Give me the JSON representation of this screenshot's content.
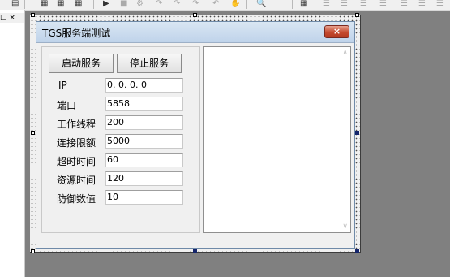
{
  "toolbar": {
    "icons": [
      "toolbar-icon-a",
      "toolbar-icon-b",
      "toolbar-icon-c",
      "run-icon",
      "stop-icon",
      "debug-icon",
      "step-into-icon",
      "step-over-icon",
      "step-out-icon",
      "hand-icon",
      "find-icon",
      "grid-icon",
      "align-icon"
    ]
  },
  "left_panel": {
    "header": "□ ×"
  },
  "dialog": {
    "title": "TGS服务端测试",
    "close_label": "×",
    "buttons": {
      "start": "启动服务",
      "stop": "停止服务"
    },
    "fields": [
      {
        "label": "IP",
        "value": "0. 0. 0. 0"
      },
      {
        "label": "端口",
        "value": "5858"
      },
      {
        "label": "工作线程",
        "value": "200"
      },
      {
        "label": "连接限额",
        "value": "5000"
      },
      {
        "label": "超时时间",
        "value": "60"
      },
      {
        "label": "资源时间",
        "value": "120"
      },
      {
        "label": "防御数值",
        "value": "10"
      }
    ],
    "listbox": {
      "scroll_up": "∧",
      "scroll_down": "∨"
    }
  },
  "colors": {
    "titlebar": "#cddcee",
    "close": "#c54a2f",
    "selection_handle": "#14256b"
  }
}
